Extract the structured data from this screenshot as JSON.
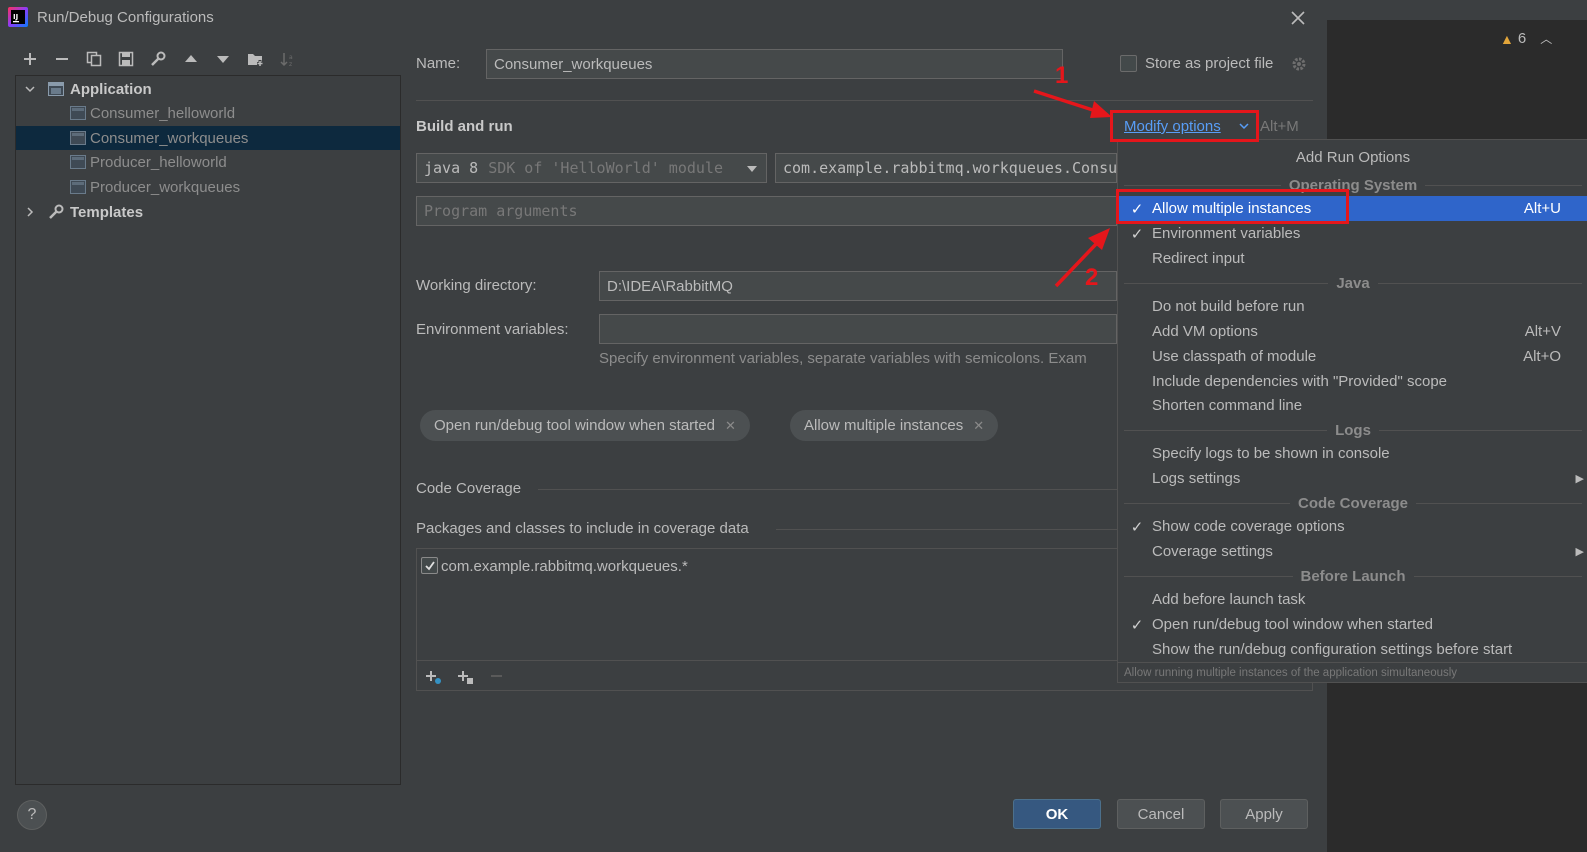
{
  "window": {
    "title": "Run/Debug Configurations"
  },
  "editor": {
    "warning_count": "6"
  },
  "toolbar": {
    "icons": [
      "plus-icon",
      "minus-icon",
      "copy-icon",
      "save-icon",
      "wrench-icon",
      "arrow-up-icon",
      "arrow-down-icon",
      "folder-add-icon",
      "sort-icon"
    ]
  },
  "tree": {
    "application_label": "Application",
    "items": [
      "Consumer_helloworld",
      "Consumer_workqueues",
      "Producer_helloworld",
      "Producer_workqueues"
    ],
    "selected_index": 1,
    "templates_label": "Templates"
  },
  "config": {
    "name_label": "Name:",
    "name_value": "Consumer_workqueues",
    "store_label": "Store as project file",
    "build_run_label": "Build and run",
    "modify_options_label": "Modify options",
    "modify_options_shortcut": "Alt+M",
    "sdk_value": "java 8",
    "sdk_hint": "SDK of 'HelloWorld' module",
    "main_class_value": "com.example.rabbitmq.workqueues.Consum",
    "program_args_placeholder": "Program arguments",
    "working_dir_label": "Working directory:",
    "working_dir_value": "D:\\IDEA\\RabbitMQ",
    "env_vars_label": "Environment variables:",
    "env_vars_value": "",
    "env_vars_hint": "Specify environment variables, separate variables with semicolons. Exam",
    "chips": [
      "Open run/debug tool window when started",
      "Allow multiple instances"
    ],
    "code_coverage_label": "Code Coverage",
    "packages_label": "Packages and classes to include in coverage data",
    "coverage_entry": "com.example.rabbitmq.workqueues.*"
  },
  "buttons": {
    "ok": "OK",
    "cancel": "Cancel",
    "apply": "Apply",
    "help": "?"
  },
  "popup": {
    "title": "Add Run Options",
    "groups": {
      "os": "Operating System",
      "java": "Java",
      "logs": "Logs",
      "coverage": "Code Coverage",
      "before": "Before Launch"
    },
    "items": {
      "allow_multiple": {
        "label": "Allow multiple instances",
        "shortcut": "Alt+U",
        "checked": true
      },
      "env_vars": {
        "label": "Environment variables",
        "checked": true
      },
      "redirect": {
        "label": "Redirect input"
      },
      "no_build": {
        "label": "Do not build before run"
      },
      "vm_options": {
        "label": "Add VM options",
        "shortcut": "Alt+V"
      },
      "classpath": {
        "label": "Use classpath of module",
        "shortcut": "Alt+O"
      },
      "provided": {
        "label": "Include dependencies with \"Provided\" scope"
      },
      "shorten": {
        "label": "Shorten command line"
      },
      "logs_console": {
        "label": "Specify logs to be shown in console"
      },
      "logs_settings": {
        "label": "Logs settings"
      },
      "show_coverage": {
        "label": "Show code coverage options",
        "checked": true
      },
      "coverage_settings": {
        "label": "Coverage settings"
      },
      "before_launch": {
        "label": "Add before launch task"
      },
      "open_tool_window": {
        "label": "Open run/debug tool window when started",
        "checked": true
      },
      "show_settings": {
        "label": "Show the run/debug configuration settings before start"
      }
    },
    "footer": "Allow running multiple instances of the application simultaneously",
    "check_glyph": "✓"
  },
  "annotations": {
    "step1": "1",
    "step2": "2"
  },
  "colors": {
    "highlight": "#2f65ca",
    "annotation_red": "#e5161b",
    "link": "#589df6"
  }
}
